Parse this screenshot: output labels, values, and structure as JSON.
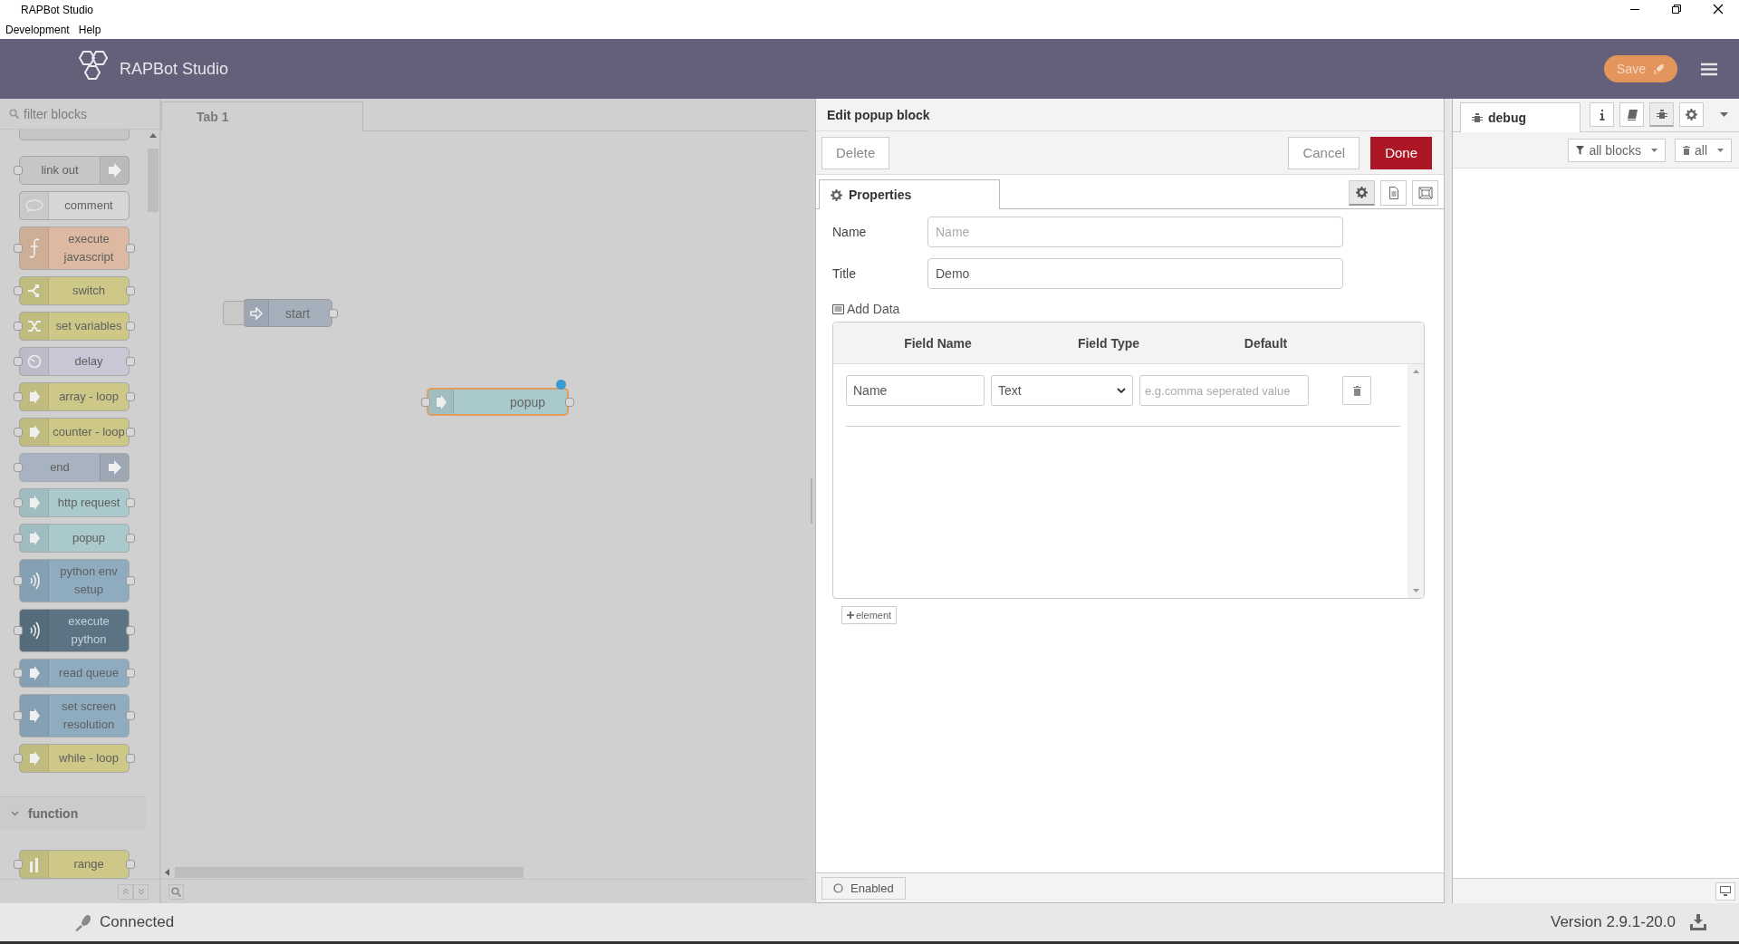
{
  "window": {
    "title": "RAPBot Studio"
  },
  "menu_bar": [
    {
      "label": "Development"
    },
    {
      "label": "Help"
    }
  ],
  "header": {
    "title": "RAPBot Studio",
    "save_button": "Save"
  },
  "palette": {
    "search": {
      "placeholder": "filter blocks"
    },
    "blocks": [
      {
        "label": "link out",
        "kind": "exit",
        "color": "#c6c6c6"
      },
      {
        "label": "comment",
        "kind": "comment",
        "color": "#d6d6d6"
      },
      {
        "label": "execute javascript",
        "kind": "function",
        "color": "#dcb9a0"
      },
      {
        "label": "switch",
        "kind": "switch",
        "color": "#cdc887"
      },
      {
        "label": "set variables",
        "kind": "change",
        "color": "#cdc887"
      },
      {
        "label": "delay",
        "kind": "delay",
        "color": "#c9c6d6"
      },
      {
        "label": "array - loop",
        "kind": "arrow",
        "color": "#cdc887"
      },
      {
        "label": "counter - loop",
        "kind": "arrow",
        "color": "#cdc887"
      },
      {
        "label": "end",
        "kind": "exit",
        "color": "#a7b3c0"
      },
      {
        "label": "http request",
        "kind": "arrow",
        "color": "#a9c9cd"
      },
      {
        "label": "popup",
        "kind": "arrow",
        "color": "#a9c9cd"
      },
      {
        "label": "python env setup",
        "kind": "python",
        "color": "#8eabbf"
      },
      {
        "label": "execute python",
        "kind": "python",
        "color": "#5b7383"
      },
      {
        "label": "read queue",
        "kind": "arrow",
        "color": "#8eabbf"
      },
      {
        "label": "set screen resolution",
        "kind": "arrow",
        "color": "#8eabbf"
      },
      {
        "label": "while - loop",
        "kind": "arrow",
        "color": "#cdc887"
      }
    ],
    "categories": [
      {
        "label": "function",
        "expanded": true,
        "blocks": [
          {
            "label": "range",
            "kind": "range",
            "color": "#cdc887"
          }
        ]
      }
    ]
  },
  "workspace": {
    "tabs": [
      {
        "label": "Tab 1",
        "selected": true
      }
    ],
    "nodes": [
      {
        "label": "start",
        "kind": "inject",
        "color": "#a6b0bd",
        "selected": false,
        "changed": false
      },
      {
        "label": "popup",
        "kind": "arrow",
        "color": "#a9c9cd",
        "selected": true,
        "changed": true
      }
    ]
  },
  "editor": {
    "title": "Edit popup block",
    "delete_button": "Delete",
    "cancel_button": "Cancel",
    "done_button": "Done",
    "tabs": [
      {
        "label": "Properties",
        "selected": true
      }
    ],
    "view_buttons": [
      {
        "kind": "gear",
        "selected": true
      },
      {
        "kind": "description",
        "selected": false
      },
      {
        "kind": "appearance",
        "selected": false
      }
    ],
    "fields": [
      {
        "label": "Name",
        "placeholder": "Name"
      },
      {
        "label": "Title",
        "value": "Demo"
      }
    ],
    "add_data": {
      "title": "Add Data",
      "columns": [
        "Field Name",
        "Field Type",
        "Default"
      ],
      "rows": [
        {
          "field_name": {
            "value": "Name"
          },
          "field_type": {
            "value": "Text"
          },
          "default": {
            "placeholder": "e.g.comma seperated value"
          }
        }
      ],
      "add_button": "element"
    },
    "enabled_button": "Enabled"
  },
  "sidebar": {
    "tabs": [
      {
        "label": "debug",
        "selected": true
      }
    ],
    "tool_buttons": [
      {
        "kind": "info",
        "selected": false
      },
      {
        "kind": "book",
        "selected": false
      },
      {
        "kind": "bug",
        "selected": true
      },
      {
        "kind": "gear",
        "selected": false
      }
    ],
    "filter_button": "all blocks",
    "clear_button": "all"
  },
  "status_bar": {
    "connection": "Connected",
    "version": "Version 2.9.1-20.0"
  }
}
